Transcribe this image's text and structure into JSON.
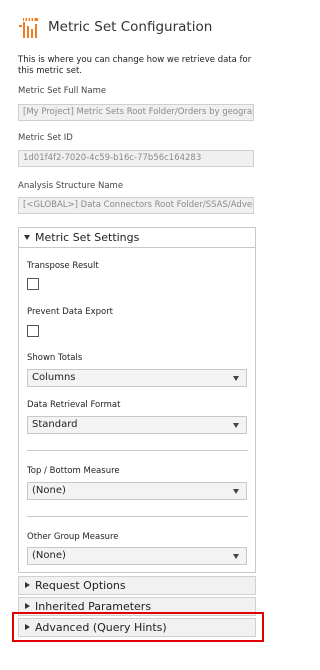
{
  "header": {
    "title": "Metric Set Configuration",
    "icon": "metric-set-icon",
    "icon_color": "#f07c22"
  },
  "description": "This is where you can change how we retrieve data for this metric set.",
  "fields": {
    "full_name": {
      "label": "Metric Set Full Name",
      "value": "[My Project] Metric Sets Root Folder/Orders by geograpl"
    },
    "id": {
      "label": "Metric Set ID",
      "value": "1d01f4f2-7020-4c59-b16c-77b56c164283"
    },
    "analysis_structure": {
      "label": "Analysis Structure Name",
      "value": "[<GLOBAL>] Data Connectors Root Folder/SSAS/Advent"
    }
  },
  "settings_panel": {
    "title": "Metric Set Settings",
    "transpose_result": {
      "label": "Transpose Result",
      "checked": false
    },
    "prevent_data_export": {
      "label": "Prevent Data Export",
      "checked": false
    },
    "shown_totals": {
      "label": "Shown Totals",
      "value": "Columns"
    },
    "data_retrieval_format": {
      "label": "Data Retrieval Format",
      "value": "Standard"
    },
    "top_bottom_measure": {
      "label": "Top / Bottom Measure",
      "value": "(None)"
    },
    "other_group_measure": {
      "label": "Other Group Measure",
      "value": "(None)"
    }
  },
  "sections": {
    "request_options": "Request Options",
    "inherited_parameters": "Inherited Parameters",
    "advanced": "Advanced (Query Hints)"
  },
  "colors": {
    "highlight": "#e00000"
  }
}
